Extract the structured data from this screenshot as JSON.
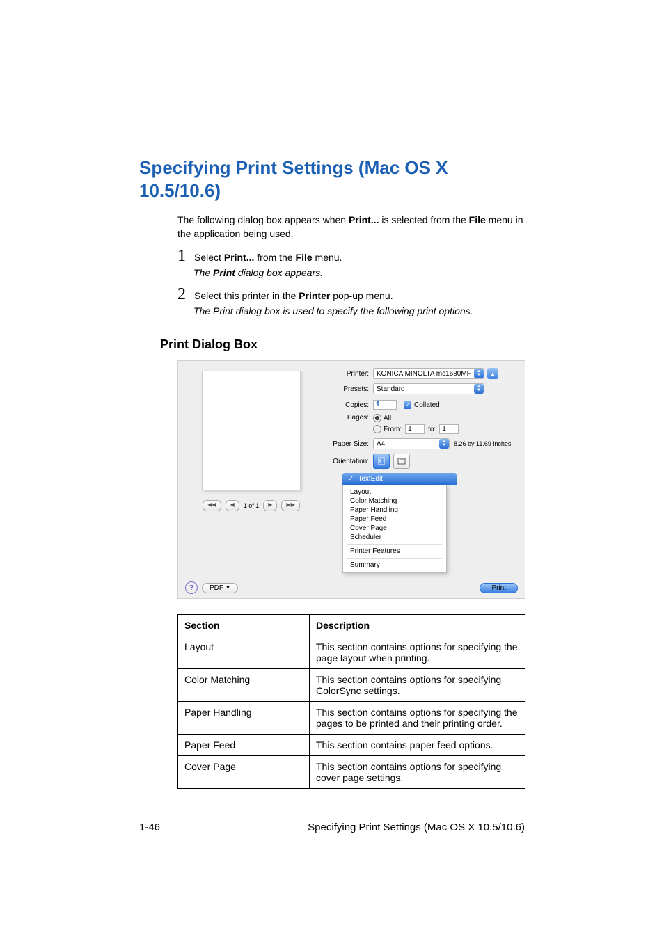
{
  "heading": "Specifying Print Settings (Mac OS X 10.5/10.6)",
  "intro_pre": "The following dialog box appears when ",
  "intro_bold1": "Print...",
  "intro_mid": " is selected from the ",
  "intro_bold2": "File",
  "intro_post": " menu in the application being used.",
  "step1_num": "1",
  "step1_pre": "Select ",
  "step1_b1": "Print...",
  "step1_mid": " from the ",
  "step1_b2": "File",
  "step1_post": " menu.",
  "step1_note_pre": "The ",
  "step1_note_bold": "Print",
  "step1_note_post": " dialog box appears.",
  "step2_num": "2",
  "step2_pre": "Select this printer in the ",
  "step2_b1": "Printer",
  "step2_post": " pop-up menu.",
  "step2_note": "The Print dialog box is used to specify the following print options.",
  "subheading": "Print Dialog Box",
  "dlg": {
    "printer_label": "Printer:",
    "printer_value": "KONICA MINOLTA mc1680MF",
    "presets_label": "Presets:",
    "presets_value": "Standard",
    "copies_label": "Copies:",
    "copies_value": "1",
    "collated": "Collated",
    "pages_label": "Pages:",
    "pages_all": "All",
    "pages_from": "From:",
    "pages_from_val": "1",
    "pages_to": "to:",
    "pages_to_val": "1",
    "papersize_label": "Paper Size:",
    "papersize_value": "A4",
    "papersize_dims": "8.26 by 11.69 inches",
    "orient_label": "Orientation:",
    "menu_sel": "TextEdit",
    "menu_items": [
      "Layout",
      "Color Matching",
      "Paper Handling",
      "Paper Feed",
      "Cover Page",
      "Scheduler"
    ],
    "menu_items2": [
      "Printer Features"
    ],
    "menu_items3": [
      "Summary"
    ],
    "pager_first": "◀◀",
    "pager_prev": "◀",
    "pager_text": "1 of 1",
    "pager_next": "▶",
    "pager_last": "▶▶",
    "help": "?",
    "pdf": "PDF",
    "print": "Print"
  },
  "table": {
    "h1": "Section",
    "h2": "Description",
    "rows": [
      {
        "s": "Layout",
        "d": "This section contains options for specifying the page layout when printing."
      },
      {
        "s": "Color Matching",
        "d": "This section contains options for specifying ColorSync settings."
      },
      {
        "s": "Paper Handling",
        "d": "This section contains options for specifying the pages to be printed and their printing order."
      },
      {
        "s": "Paper Feed",
        "d": "This section contains paper feed options."
      },
      {
        "s": "Cover Page",
        "d": "This section contains options for specifying cover page settings."
      }
    ]
  },
  "footer_page": "1-46",
  "footer_title": "Specifying Print Settings (Mac OS X 10.5/10.6)"
}
